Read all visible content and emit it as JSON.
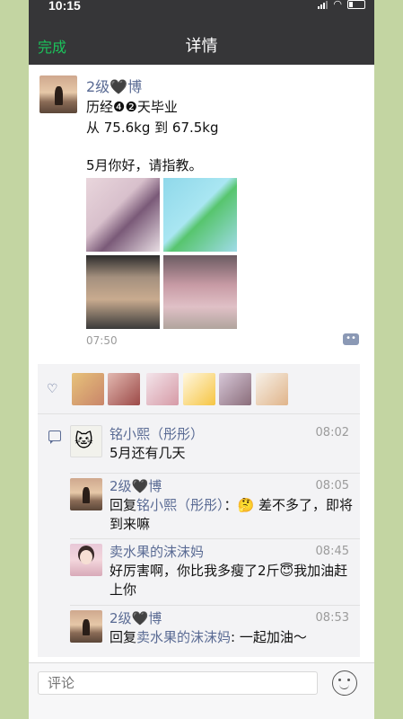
{
  "status": {
    "time": "10:15"
  },
  "nav": {
    "done": "完成",
    "title": "详情"
  },
  "post": {
    "author": "2级🖤博",
    "lines": [
      "历经❹❷天毕业",
      "从 75.6kg 到 67.5kg",
      "5月你好，请指教。"
    ],
    "time": "07:50"
  },
  "comments": [
    {
      "name": "铭小熙（彤彤）",
      "time": "08:02",
      "text": "5月还有几天"
    },
    {
      "name": "2级🖤博",
      "time": "08:05",
      "reply_prefix": "回复",
      "reply_to": "铭小熙（彤彤）",
      "text": "：🤔 差不多了，即将到来嘛"
    },
    {
      "name": "卖水果的沫沫妈",
      "time": "08:45",
      "text": "好厉害啊，你比我多瘦了2斤😇我加油赶上你"
    },
    {
      "name": "2级🖤博",
      "time": "08:53",
      "reply_prefix": "回复",
      "reply_to": "卖水果的沫沫妈",
      "text": ": 一起加油～"
    }
  ],
  "input": {
    "placeholder": "评论"
  },
  "icons": {
    "like": "heart-icon",
    "comment": "comment-icon",
    "emoji": "emoji-icon",
    "more": "more-icon"
  }
}
